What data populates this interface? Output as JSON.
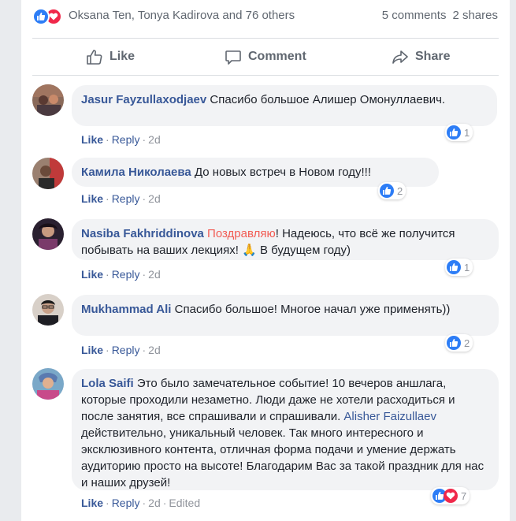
{
  "summary": {
    "names": "Oksana Ten, Tonya Kadirova and 76 others",
    "comments": "5 comments",
    "shares": "2 shares"
  },
  "actions": {
    "like": "Like",
    "comment": "Comment",
    "share": "Share"
  },
  "colors": {
    "like_blue": "#2d7df6",
    "love_red": "#f0284a",
    "link": "#385898",
    "bubble": "#f2f3f5"
  },
  "comments": [
    {
      "author": "Jasur Fayzullaxodjaev",
      "text": "Спасибо большое Алишер Омонуллаевич.",
      "like": "Like",
      "reply": "Reply",
      "time": "2d",
      "reactions": "1"
    },
    {
      "author": "Камила Николаева",
      "text": "До новых встреч в Новом году!!!",
      "like": "Like",
      "reply": "Reply",
      "time": "2d",
      "reactions": "2"
    },
    {
      "author": "Nasiba Fakhriddinova",
      "highlight": "Поздравляю",
      "text": "! Надеюсь, что всё же получится побывать на ваших лекциях! 🙏 В будущем году)",
      "like": "Like",
      "reply": "Reply",
      "time": "2d",
      "reactions": "1"
    },
    {
      "author": "Mukhammad Ali",
      "text": "Спасибо большое! Многое начал уже применять))",
      "like": "Like",
      "reply": "Reply",
      "time": "2d",
      "reactions": "2"
    },
    {
      "author": "Lola Saifi",
      "text_before": "Это было замечательное событие! 10 вечеров аншлага, которые проходили незаметно. Люди даже не хотели расходиться и после занятия, все спрашивали и спрашивали.",
      "mention": "Alisher Faizullaev",
      "text_after": "действительно, уникальный человек. Так много интересного и эксклюзивного контента, отличная форма подачи и умение держать аудиторию просто на высоте! Благодарим Вас за такой праздник для нас и наших друзей!",
      "like": "Like",
      "reply": "Reply",
      "time": "2d",
      "edited": "Edited",
      "reactions": "7"
    }
  ]
}
